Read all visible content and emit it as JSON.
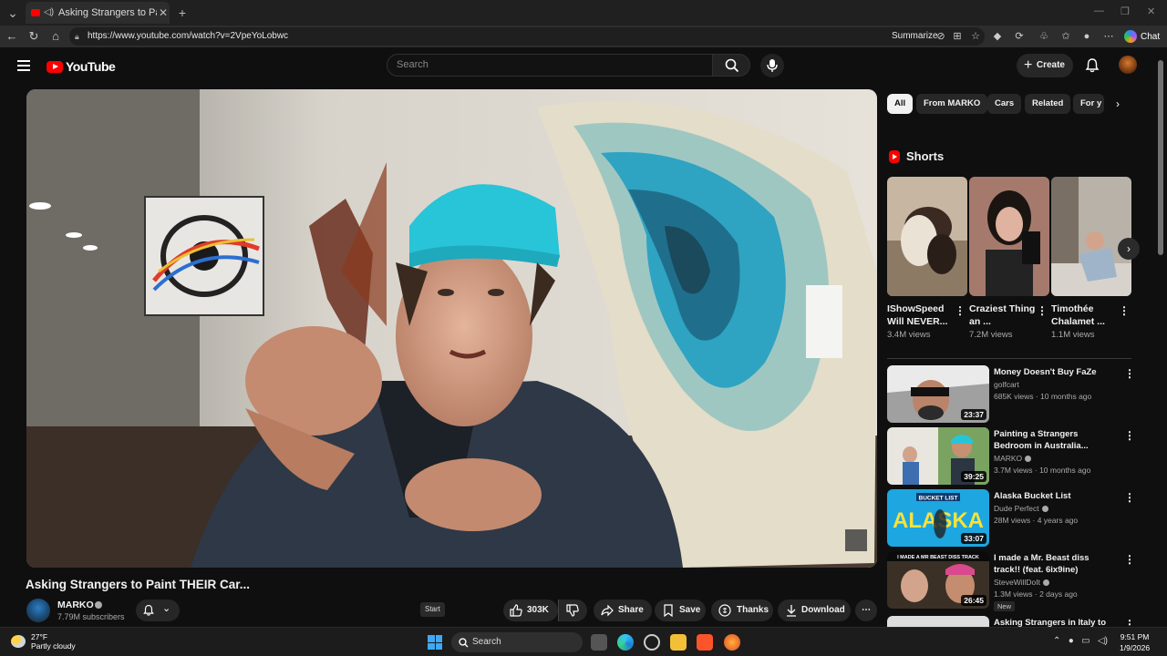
{
  "browser": {
    "tab_title": "Asking Strangers to Paint THE",
    "url": "https://www.youtube.com/watch?v=2VpeYoLobwc",
    "summarize_label": "Summarize",
    "chat_label": "Chat"
  },
  "header": {
    "logo_text": "YouTube",
    "search_placeholder": "Search",
    "create_label": "Create"
  },
  "video": {
    "title": "Asking Strangers to Paint THEIR Car...",
    "channel": "MARKO",
    "subscribers": "7.79M subscribers",
    "tooltip": "Start",
    "like_count": "303K",
    "share_label": "Share",
    "save_label": "Save",
    "thanks_label": "Thanks",
    "download_label": "Download"
  },
  "chips": [
    "All",
    "From MARKO",
    "Cars",
    "Related",
    "For y"
  ],
  "shorts": {
    "heading": "Shorts",
    "items": [
      {
        "title": "IShowSpeed Will NEVER...",
        "views": "3.4M views"
      },
      {
        "title": "Craziest Thing an ...",
        "views": "7.2M views"
      },
      {
        "title": "Timothée Chalamet ...",
        "views": "1.1M views"
      }
    ]
  },
  "recommendations": [
    {
      "title": "Money Doesn't Buy FaZe",
      "channel": "golfcart",
      "meta": "685K views · 10 months ago",
      "duration": "23:37",
      "verified": false
    },
    {
      "title": "Painting a Strangers Bedroom in Australia...",
      "channel": "MARKO",
      "meta": "3.7M views · 10 months ago",
      "duration": "39:25",
      "verified": true
    },
    {
      "title": "Alaska Bucket List",
      "channel": "Dude Perfect",
      "meta": "28M views · 4 years ago",
      "duration": "33:07",
      "verified": true
    },
    {
      "title": "I made a Mr. Beast diss track!! (feat. 6ix9ine)",
      "channel": "SteveWillDoIt",
      "meta": "1.3M views · 2 days ago",
      "duration": "26:45",
      "verified": true,
      "badge": "New"
    },
    {
      "title": "Asking Strangers in Italy to",
      "channel": "",
      "meta": "",
      "duration": "",
      "verified": false
    }
  ],
  "thumbnail_text": {
    "alaska_banner": "BUCKET LIST",
    "alaska_word": "ALASKA",
    "beast_caption": "I MADE A MR BEAST DISS TRACK"
  },
  "taskbar": {
    "temperature": "27°F",
    "condition": "Partly cloudy",
    "search_label": "Search",
    "time": "9:51 PM",
    "date": "1/9/2026"
  },
  "colors": {
    "accent_red": "#ff0000",
    "background": "#0f0f0f",
    "chip_bg": "#272727"
  }
}
